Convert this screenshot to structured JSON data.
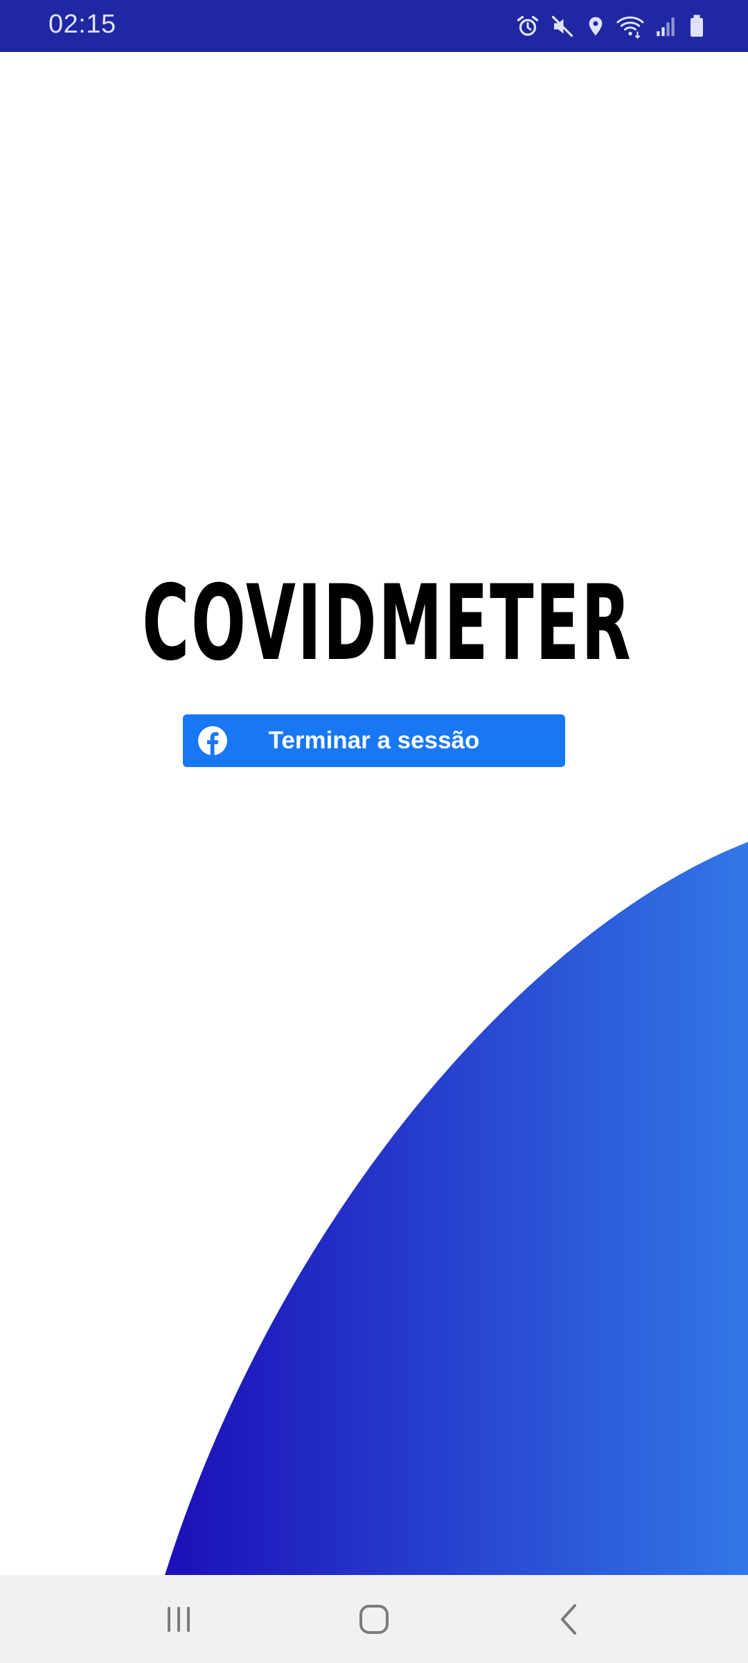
{
  "status_bar": {
    "time": "02:15",
    "icons": [
      "alarm-icon",
      "mute-icon",
      "location-icon",
      "wifi-icon",
      "signal-icon",
      "battery-icon"
    ],
    "background": "#1f27a2"
  },
  "app": {
    "title": "COVIDMETER"
  },
  "login_button": {
    "label": "Terminar a sessão",
    "icon": "facebook-icon",
    "color": "#1877f2"
  },
  "decoration": {
    "gradient_start": "#1c0fb8",
    "gradient_end": "#3277e6"
  },
  "nav_bar": {
    "buttons": [
      "recent-apps-icon",
      "home-icon",
      "back-icon"
    ]
  }
}
